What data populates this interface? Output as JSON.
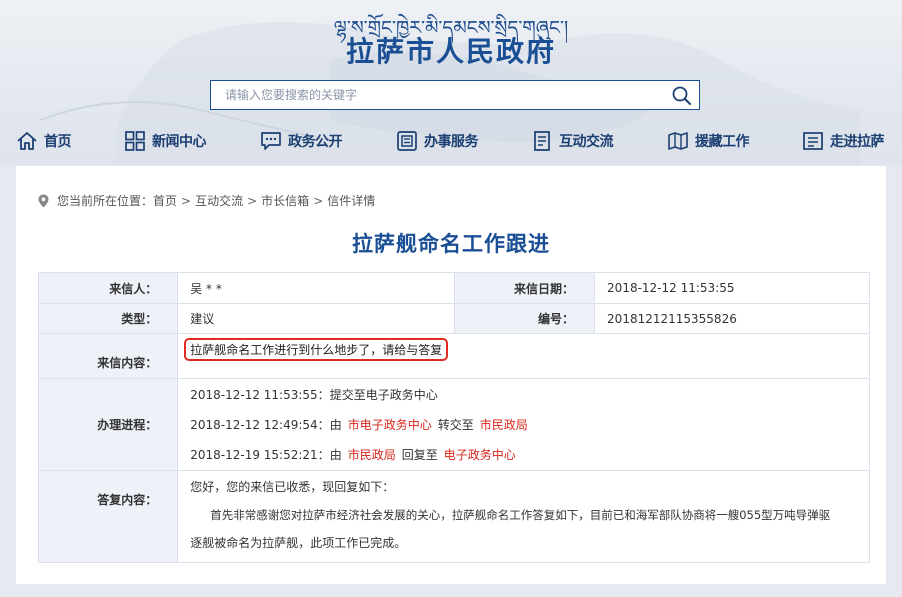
{
  "header": {
    "tibetan_title": "ལྷ་ས་གྲོང་ཁྱེར་མི་དམངས་སྲིད་གཞུང་།",
    "site_title": "拉萨市人民政府",
    "search_placeholder": "请输入您要搜索的关键字"
  },
  "nav": [
    {
      "label": "首页",
      "icon": "home-icon"
    },
    {
      "label": "新闻中心",
      "icon": "grid-icon"
    },
    {
      "label": "政务公开",
      "icon": "chat-icon"
    },
    {
      "label": "办事服务",
      "icon": "document-icon"
    },
    {
      "label": "互动交流",
      "icon": "list-icon"
    },
    {
      "label": "援藏工作",
      "icon": "map-icon"
    },
    {
      "label": "走进拉萨",
      "icon": "board-icon"
    }
  ],
  "breadcrumb": {
    "prefix": "您当前所在位置：",
    "items": [
      "首页",
      "互动交流",
      "市长信箱",
      "信件详情"
    ],
    "separator": ">"
  },
  "letter": {
    "title": "拉萨舰命名工作跟进",
    "sender_label": "来信人：",
    "sender": "吴 * *",
    "date_label": "来信日期：",
    "date": "2018-12-12 11:53:55",
    "type_label": "类型：",
    "type": "建议",
    "number_label": "编号：",
    "number": "20181212115355826",
    "content_label": "来信内容：",
    "content": "拉萨舰命名工作进行到什么地步了，请给与答复",
    "process_label": "办理进程：",
    "process": [
      {
        "time": "2018-12-12 11:53:55：",
        "text": "提交至电子政务中心"
      },
      {
        "time": "2018-12-12 12:49:54：",
        "pre": "由",
        "from": "市电子政务中心",
        "mid": "转交至",
        "to": "市民政局"
      },
      {
        "time": "2018-12-19 15:52:21：",
        "pre": "由",
        "from": "市民政局",
        "mid": "回复至",
        "to": "电子政务中心"
      }
    ],
    "reply_label": "答复内容：",
    "reply": [
      "您好，您的来信已收悉，现回复如下：",
      "首先非常感谢您对拉萨市经济社会发展的关心，拉萨舰命名工作答复如下，目前已和海军部队协商将一艘055型万吨导弹驱",
      "逐舰被命名为拉萨舰，此项工作已完成。"
    ]
  },
  "colors": {
    "brand": "#1b4f95",
    "highlight_border": "#e02b20",
    "red_text": "#d9261c",
    "label_bg": "#eef2f8"
  }
}
